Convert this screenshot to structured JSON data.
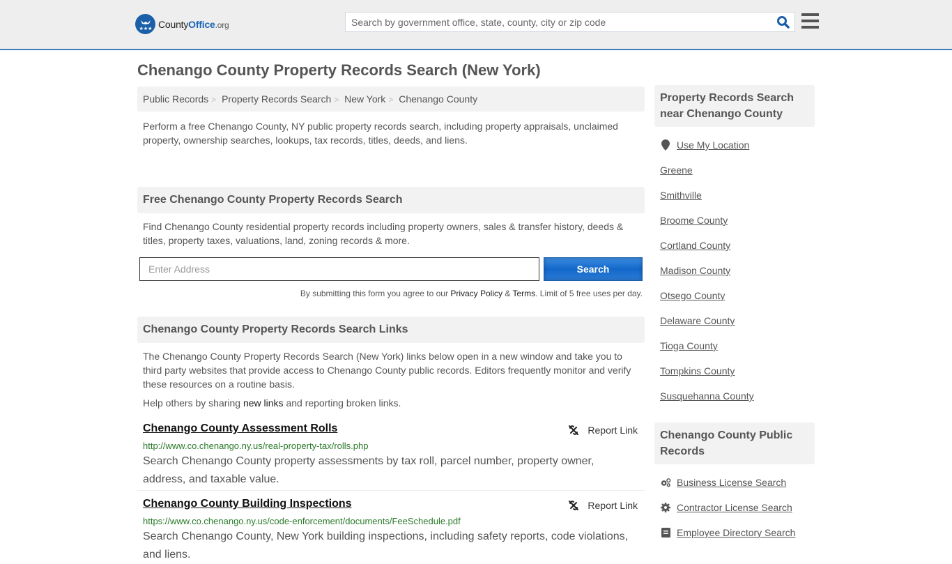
{
  "header": {
    "logo": {
      "part1": "County",
      "part2": "Office",
      "part3": ".org"
    },
    "search_placeholder": "Search by government office, state, county, city or zip code",
    "search_icon": "search-icon",
    "menu_icon": "hamburger-menu-icon",
    "accent_color": "#1a66b8"
  },
  "page_title": "Chenango County Property Records Search (New York)",
  "breadcrumb": [
    {
      "label": "Public Records"
    },
    {
      "label": "Property Records Search"
    },
    {
      "label": "New York"
    },
    {
      "label": "Chenango County"
    }
  ],
  "breadcrumb_separator": ">",
  "intro": "Perform a free Chenango County, NY public property records search, including property appraisals, unclaimed property, ownership searches, lookups, tax records, titles, deeds, and liens.",
  "free_search": {
    "heading": "Free Chenango County Property Records Search",
    "text": "Find Chenango County residential property records including property owners, sales & transfer history, deeds & titles, property taxes, valuations, land, zoning records & more.",
    "input_placeholder": "Enter Address",
    "button_label": "Search",
    "disclaimer_pre": "By submitting this form you agree to our ",
    "privacy_label": "Privacy Policy",
    "amp": " & ",
    "terms_label": "Terms",
    "disclaimer_post": ". Limit of 5 free uses per day."
  },
  "links_section": {
    "heading": "Chenango County Property Records Search Links",
    "text": "The Chenango County Property Records Search (New York) links below open in a new window and take you to third party websites that provide access to Chenango County public records. Editors frequently monitor and verify these resources on a routine basis.",
    "help_pre": "Help others by sharing ",
    "help_link": "new links",
    "help_post": " and reporting broken links.",
    "report_label": "Report Link",
    "results": [
      {
        "title": "Chenango County Assessment Rolls",
        "url": "http://www.co.chenango.ny.us/real-property-tax/rolls.php",
        "description": "Search Chenango County property assessments by tax roll, parcel number, property owner, address, and taxable value."
      },
      {
        "title": "Chenango County Building Inspections",
        "url": "https://www.co.chenango.ny.us/code-enforcement/documents/FeeSchedule.pdf",
        "description": "Search Chenango County, New York building inspections, including safety reports, code violations, and liens."
      }
    ]
  },
  "sidebar": {
    "nearby_heading": "Property Records Search near Chenango County",
    "use_location": "Use My Location",
    "nearby": [
      "Greene",
      "Smithville",
      "Broome County",
      "Cortland County",
      "Madison County",
      "Otsego County",
      "Delaware County",
      "Tioga County",
      "Tompkins County",
      "Susquehanna County"
    ],
    "public_heading": "Chenango County Public Records",
    "public_links": [
      {
        "label": "Business License Search",
        "icon": "cogs-icon"
      },
      {
        "label": "Contractor License Search",
        "icon": "gear-icon"
      },
      {
        "label": "Employee Directory Search",
        "icon": "directory-icon"
      }
    ]
  }
}
